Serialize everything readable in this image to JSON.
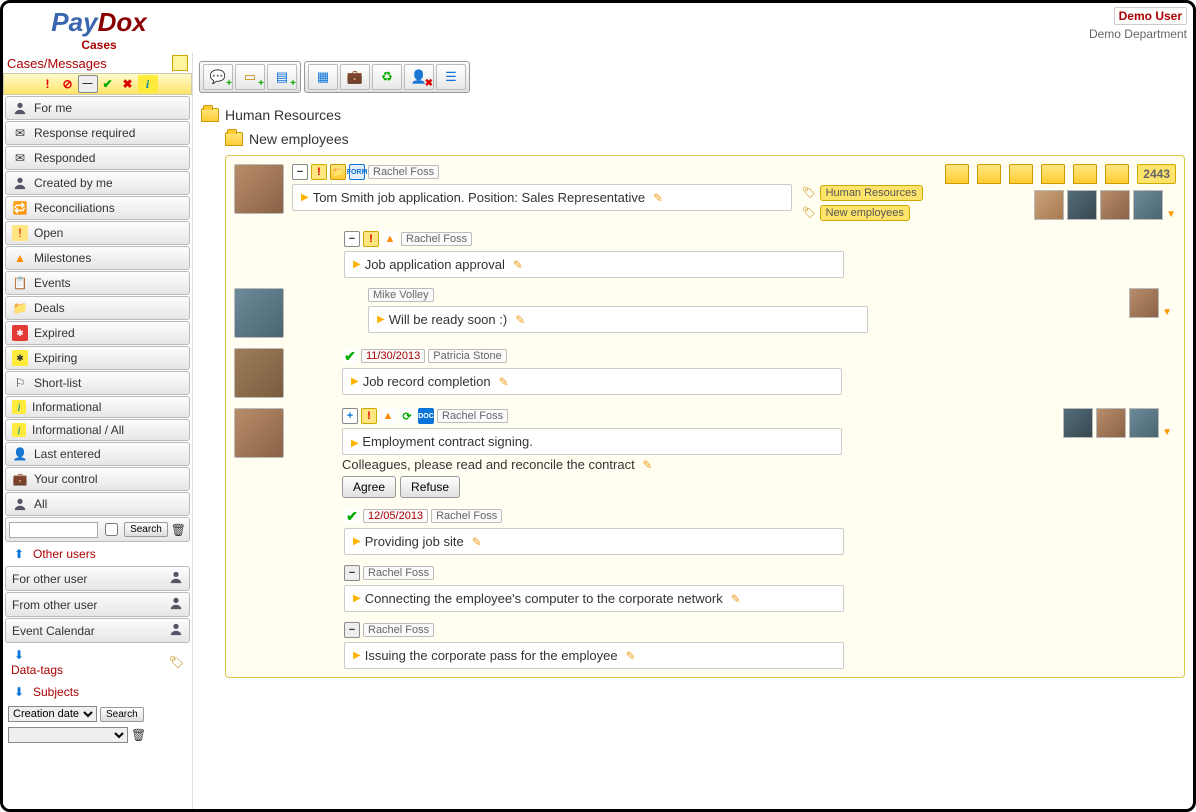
{
  "app": {
    "logo1": "Pay",
    "logo2": "Dox",
    "subtitle": "Cases"
  },
  "user": {
    "name": "Demo User",
    "dept": "Demo Department"
  },
  "sidebar": {
    "title": "Cases/Messages",
    "items": [
      {
        "label": "For me"
      },
      {
        "label": "Response required"
      },
      {
        "label": "Responded"
      },
      {
        "label": "Created by me"
      },
      {
        "label": "Reconciliations"
      },
      {
        "label": "Open"
      },
      {
        "label": "Milestones"
      },
      {
        "label": "Events"
      },
      {
        "label": "Deals"
      },
      {
        "label": "Expired"
      },
      {
        "label": "Expiring"
      },
      {
        "label": "Short-list"
      },
      {
        "label": "Informational"
      },
      {
        "label": "Informational / All"
      },
      {
        "label": "Last entered"
      },
      {
        "label": "Your control"
      },
      {
        "label": "All"
      }
    ],
    "search_btn": "Search",
    "other_users": "Other users",
    "for_other": "For other user",
    "from_other": "From other user",
    "event_cal": "Event Calendar",
    "data_tags": "Data-tags",
    "subjects": "Subjects",
    "creation_date": "Creation date",
    "search_btn2": "Search"
  },
  "breadcrumb": {
    "root": "Human Resources",
    "sub": "New employees"
  },
  "case": {
    "count": "2443",
    "author": "Rachel Foss",
    "title": "Tom Smith job application. Position: Sales Representative",
    "tags": [
      "Human Resources",
      "New employees"
    ],
    "tasks": [
      {
        "author": "Rachel Foss",
        "text": "Job application approval",
        "icons": [
          "minus",
          "excl",
          "cone"
        ],
        "indent": 1
      },
      {
        "author": "Mike Volley",
        "text": "Will be ready soon :)",
        "icons": [],
        "indent": 1,
        "avatar": true,
        "rightava": true
      },
      {
        "author": "Patricia Stone",
        "date": "11/30/2013",
        "text": "Job record completion",
        "icons": [
          "check"
        ],
        "indent": 1,
        "avatar": true
      },
      {
        "author": "Rachel Foss",
        "text": "Employment contract signing.",
        "sub": "Colleagues, please read and reconcile the contract",
        "icons": [
          "plus",
          "excl",
          "cone",
          "sync",
          "doc"
        ],
        "indent": 1,
        "avatar": true,
        "actions": true,
        "rightavas": true
      },
      {
        "author": "Rachel Foss",
        "date": "12/05/2013",
        "text": "Providing job site",
        "icons": [
          "check"
        ],
        "indent": 1
      },
      {
        "author": "Rachel Foss",
        "text": "Connecting the employee's computer to the corporate network",
        "icons": [
          "minus-g"
        ],
        "indent": 1
      },
      {
        "author": "Rachel Foss",
        "text": "Issuing the corporate pass for the employee",
        "icons": [
          "minus-g"
        ],
        "indent": 1
      }
    ],
    "agree": "Agree",
    "refuse": "Refuse"
  }
}
